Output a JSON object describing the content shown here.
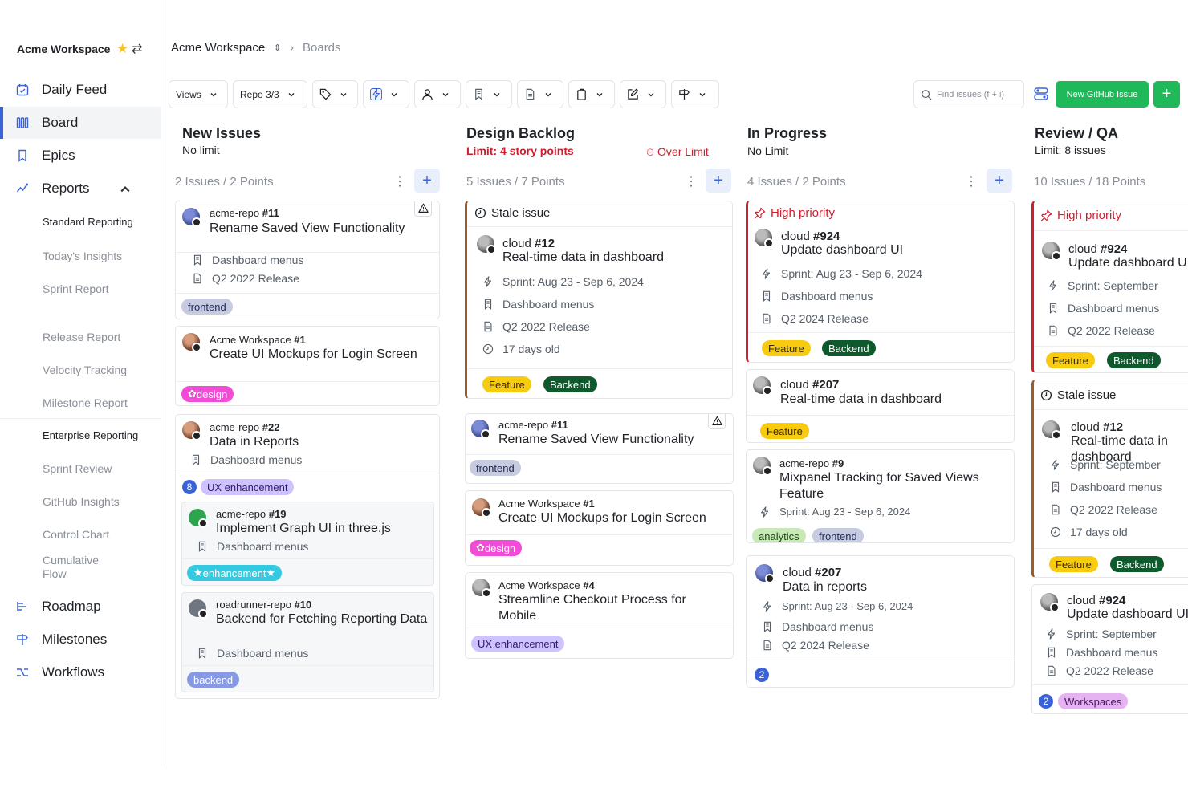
{
  "workspace": "Acme Workspace",
  "sidebar": {
    "items": [
      {
        "label": "Daily Feed"
      },
      {
        "label": "Board"
      },
      {
        "label": "Epics"
      },
      {
        "label": "Reports"
      },
      {
        "label": "Roadmap"
      },
      {
        "label": "Milestones"
      },
      {
        "label": "Workflows"
      }
    ],
    "reports": [
      "Standard Reporting",
      "Today's Insights",
      "Sprint Report",
      "Release Report",
      "Velocity Tracking",
      "Milestone Report",
      "Enterprise Reporting",
      "Sprint Review",
      "GitHub Insights",
      "Control Chart",
      "Cumulative Flow"
    ]
  },
  "breadcrumb": {
    "workspace": "Acme Workspace",
    "page": "Boards"
  },
  "toolbar": {
    "views": "Views",
    "repo": "Repo 3/3",
    "search_placeholder": "Find issues (f + i)",
    "new_issue": "New GitHub Issue",
    "add": "+"
  },
  "columns": [
    {
      "title": "New Issues",
      "limit": "No limit",
      "count": "2 Issues / 2 Points"
    },
    {
      "title": "Design Backlog",
      "limit": "Limit: 4 story points",
      "over": "Over Limit",
      "count": "5 Issues / 7 Points"
    },
    {
      "title": "In Progress",
      "limit": "No Limit",
      "count": "4 Issues / 2 Points"
    },
    {
      "title": "Review / QA",
      "limit": "Limit: 8 issues",
      "count": "10 Issues / 18 Points"
    }
  ],
  "cards": {
    "c1": {
      "repo": "acme-repo",
      "num": "#11",
      "title": "Rename Saved View Functionality",
      "epic": "Dashboard menus",
      "release": "Q2 2022 Release",
      "tag": "frontend"
    },
    "c2": {
      "repo": "Acme Workspace",
      "num": "#1",
      "title": "Create UI Mockups for Login Screen",
      "tag": "design"
    },
    "c3": {
      "repo": "acme-repo",
      "num": "#22",
      "title": "Data in Reports",
      "epic": "Dashboard menus",
      "count": "8",
      "tag": "UX enhancement"
    },
    "c3a": {
      "repo": "acme-repo",
      "num": "#19",
      "title": "Implement Graph UI in three.js",
      "epic": "Dashboard menus",
      "tag": "enhancement"
    },
    "c3b": {
      "repo": "roadrunner-repo",
      "num": "#10",
      "title": "Backend for Fetching Reporting Data",
      "epic": "Dashboard menus",
      "tag": "backend"
    },
    "d1": {
      "flag": "Stale issue",
      "repo": "cloud",
      "num": "#12",
      "title": "Real-time data in dashboard",
      "sprint": "Sprint: Aug 23 - Sep 6, 2024",
      "epic": "Dashboard menus",
      "release": "Q2 2022 Release",
      "age": "17 days old",
      "tag1": "Feature",
      "tag2": "Backend"
    },
    "d2": {
      "repo": "acme-repo",
      "num": "#11",
      "title": "Rename Saved View Functionality",
      "tag": "frontend"
    },
    "d3": {
      "repo": "Acme Workspace",
      "num": "#1",
      "title": "Create UI Mockups for Login Screen",
      "tag": "design"
    },
    "d4": {
      "repo": "Acme Workspace",
      "num": "#4",
      "title": "Streamline Checkout Process for Mobile",
      "tag": "UX enhancement"
    },
    "p1": {
      "flag": "High priority",
      "repo": "cloud",
      "num": "#924",
      "title": "Update dashboard UI",
      "sprint": "Sprint: Aug 23 - Sep 6, 2024",
      "epic": "Dashboard menus",
      "release": "Q2 2024 Release",
      "tag1": "Feature",
      "tag2": "Backend"
    },
    "p2": {
      "repo": "cloud",
      "num": "#207",
      "title": "Real-time data in dashboard",
      "tag": "Feature"
    },
    "p3": {
      "repo": "acme-repo",
      "num": "#9",
      "title": "Mixpanel Tracking for Saved Views Feature",
      "sprint": "Sprint: Aug 23 - Sep 6, 2024",
      "tag1": "analytics",
      "tag2": "frontend"
    },
    "p4": {
      "repo": "cloud",
      "num": "#207",
      "title": "Data in reports",
      "sprint": "Sprint: Aug 23 - Sep 6, 2024",
      "epic": "Dashboard menus",
      "release": "Q2 2024 Release",
      "count": "2"
    },
    "r1": {
      "flag": "High priority",
      "repo": "cloud",
      "num": "#924",
      "title": "Update dashboard UI",
      "sprint": "Sprint: September",
      "epic": "Dashboard menus",
      "release": "Q2 2022 Release",
      "tag1": "Feature",
      "tag2": "Backend"
    },
    "r2": {
      "flag": "Stale issue",
      "repo": "cloud",
      "num": "#12",
      "title": "Real-time data in dashboard",
      "sprint": "Sprint: September",
      "epic": "Dashboard menus",
      "release": "Q2 2022 Release",
      "age": "17 days old",
      "tag1": "Feature",
      "tag2": "Backend"
    },
    "r3": {
      "repo": "cloud",
      "num": "#924",
      "title": "Update dashboard UI",
      "sprint": "Sprint: September",
      "epic": "Dashboard menus",
      "release": "Q2 2022 Release",
      "count": "2",
      "tag": "Workspaces"
    }
  },
  "colors": {
    "accent": "#3b63d8",
    "green": "#1fb95a",
    "danger": "#cf1f2e"
  }
}
